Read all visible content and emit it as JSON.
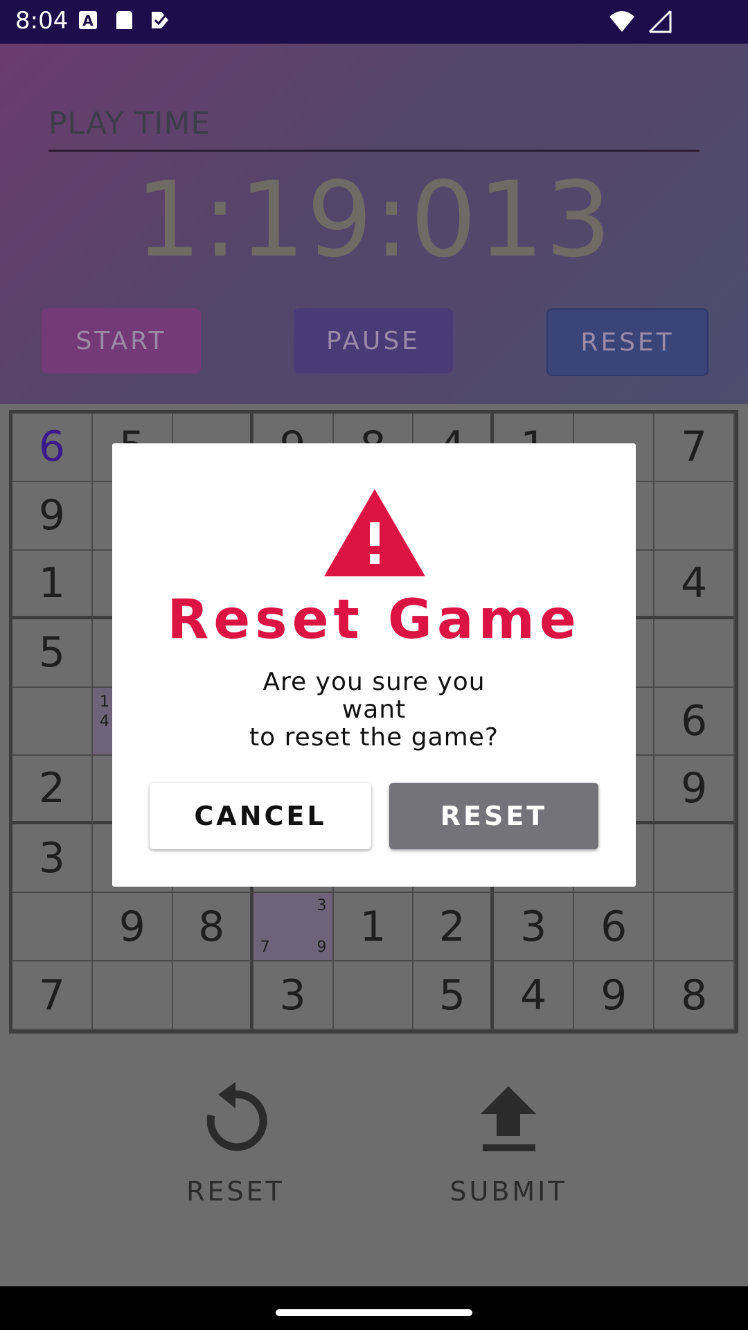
{
  "status_bar": {
    "time": "8:04"
  },
  "header": {
    "play_time_label": "PLAY TIME",
    "timer": "1:19:013",
    "start_label": "START",
    "pause_label": "PAUSE",
    "reset_label": "RESET"
  },
  "board": {
    "rows": [
      [
        "6",
        "5",
        "",
        "9",
        "8",
        "4",
        "1",
        "",
        "7"
      ],
      [
        "9",
        "",
        "",
        "",
        "",
        "",
        "",
        "",
        ""
      ],
      [
        "1",
        "",
        "",
        "",
        "",
        "",
        "",
        "",
        "4"
      ],
      [
        "5",
        "",
        "",
        "",
        "",
        "",
        "",
        "",
        ""
      ],
      [
        "",
        "",
        "",
        "",
        "",
        "",
        "",
        "",
        "6"
      ],
      [
        "2",
        "",
        "",
        "",
        "",
        "",
        "",
        "",
        "9"
      ],
      [
        "3",
        "",
        "",
        "",
        "",
        "",
        "",
        "",
        ""
      ],
      [
        "",
        "9",
        "8",
        "",
        "1",
        "2",
        "3",
        "6",
        ""
      ],
      [
        "7",
        "",
        "",
        "3",
        "",
        "5",
        "4",
        "9",
        "8"
      ]
    ],
    "notes": [
      {
        "row": 4,
        "col": 1,
        "marks": [
          "1",
          "4"
        ]
      },
      {
        "row": 7,
        "col": 3,
        "marks": [
          "3",
          "7",
          "9"
        ]
      }
    ]
  },
  "dialog": {
    "icon": "warning-icon",
    "title": "Reset Game",
    "message": "Are you sure you\nwant\nto reset the game?",
    "cancel_label": "CANCEL",
    "reset_label": "RESET"
  },
  "bottom": {
    "reset_label": "RESET",
    "submit_label": "SUBMIT"
  },
  "colors": {
    "accent_red": "#dc1443",
    "given_digit": "#3a1a8a",
    "status_bar": "#1c0e4a"
  }
}
